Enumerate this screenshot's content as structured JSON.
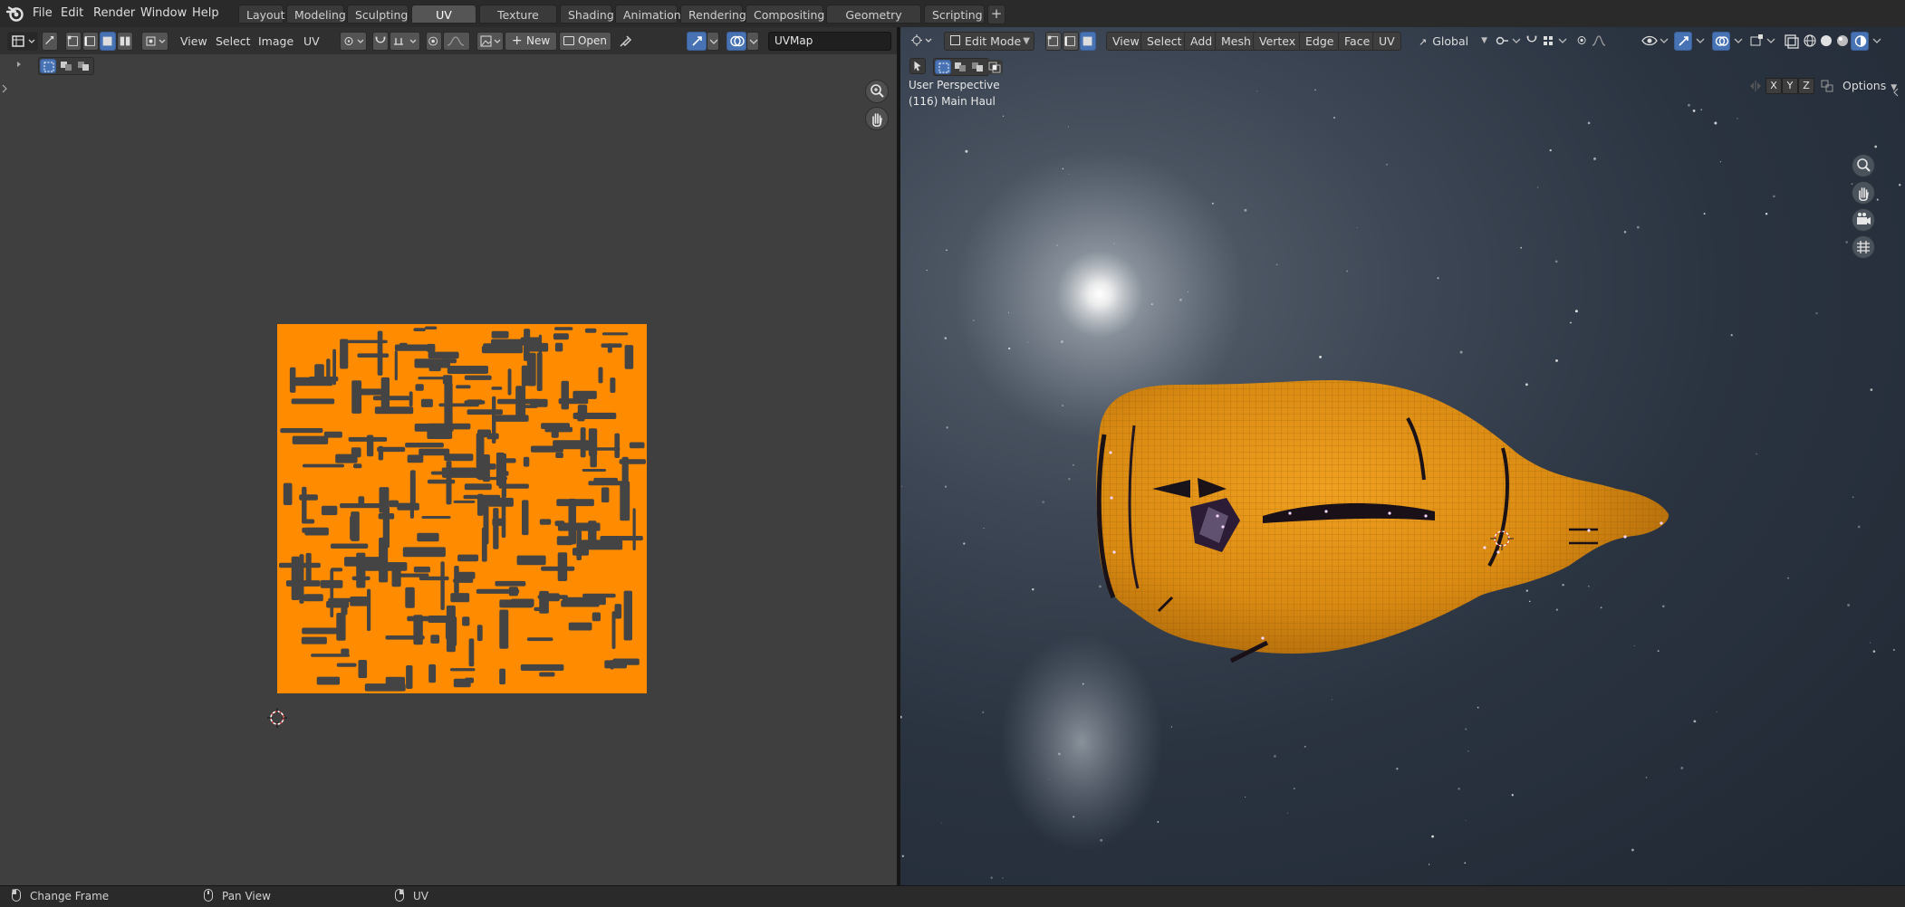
{
  "menus": [
    "File",
    "Edit",
    "Render",
    "Window",
    "Help"
  ],
  "workspace_tabs": [
    {
      "label": "Layout",
      "active": false
    },
    {
      "label": "Modeling",
      "active": false
    },
    {
      "label": "Sculpting",
      "active": false
    },
    {
      "label": "UV Editing",
      "active": true
    },
    {
      "label": "Texture Paint",
      "active": false
    },
    {
      "label": "Shading",
      "active": false
    },
    {
      "label": "Animation",
      "active": false
    },
    {
      "label": "Rendering",
      "active": false
    },
    {
      "label": "Compositing",
      "active": false
    },
    {
      "label": "Geometry Nodes",
      "active": false
    },
    {
      "label": "Scripting",
      "active": false
    }
  ],
  "workspace_add": "+",
  "uv_editor": {
    "menus": [
      "View",
      "Select",
      "Image",
      "UV"
    ],
    "new_label": "New",
    "open_label": "Open",
    "uvmap_name": "UVMap",
    "island_color": "#ff8c00",
    "background_color": "#3f3f3f"
  },
  "viewport": {
    "mode": "Edit Mode",
    "menus": [
      "View",
      "Select",
      "Add",
      "Mesh",
      "Vertex",
      "Edge",
      "Face",
      "UV"
    ],
    "orientation": "Global",
    "options_label": "Options",
    "perspective_label": "User Perspective",
    "object_label": "(116) Main Haul",
    "axes": {
      "x": "X",
      "y": "Y",
      "z": "Z"
    },
    "mesh_color": "#e08a10"
  },
  "status_bar": {
    "items": [
      {
        "icon": "mouse-left-icon",
        "label": "Change Frame"
      },
      {
        "icon": "mouse-middle-icon",
        "label": "Pan View"
      },
      {
        "icon": "mouse-right-icon",
        "label": "UV"
      }
    ]
  }
}
